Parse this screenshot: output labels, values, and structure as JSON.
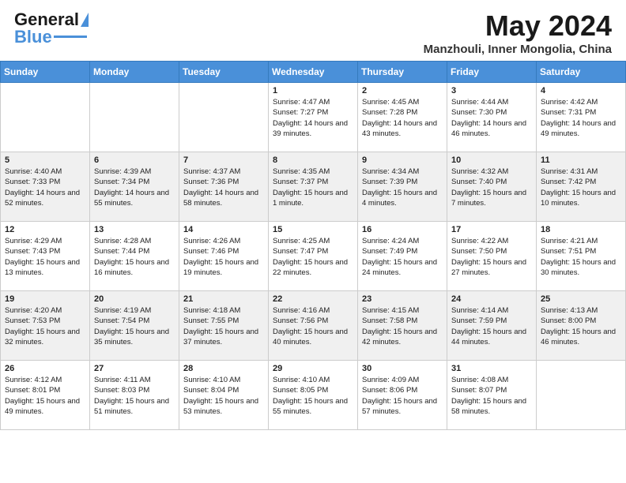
{
  "header": {
    "logo_general": "General",
    "logo_blue": "Blue",
    "month": "May 2024",
    "location": "Manzhouli, Inner Mongolia, China"
  },
  "weekdays": [
    "Sunday",
    "Monday",
    "Tuesday",
    "Wednesday",
    "Thursday",
    "Friday",
    "Saturday"
  ],
  "weeks": [
    [
      {
        "day": "",
        "sunrise": "",
        "sunset": "",
        "daylight": ""
      },
      {
        "day": "",
        "sunrise": "",
        "sunset": "",
        "daylight": ""
      },
      {
        "day": "",
        "sunrise": "",
        "sunset": "",
        "daylight": ""
      },
      {
        "day": "1",
        "sunrise": "Sunrise: 4:47 AM",
        "sunset": "Sunset: 7:27 PM",
        "daylight": "Daylight: 14 hours and 39 minutes."
      },
      {
        "day": "2",
        "sunrise": "Sunrise: 4:45 AM",
        "sunset": "Sunset: 7:28 PM",
        "daylight": "Daylight: 14 hours and 43 minutes."
      },
      {
        "day": "3",
        "sunrise": "Sunrise: 4:44 AM",
        "sunset": "Sunset: 7:30 PM",
        "daylight": "Daylight: 14 hours and 46 minutes."
      },
      {
        "day": "4",
        "sunrise": "Sunrise: 4:42 AM",
        "sunset": "Sunset: 7:31 PM",
        "daylight": "Daylight: 14 hours and 49 minutes."
      }
    ],
    [
      {
        "day": "5",
        "sunrise": "Sunrise: 4:40 AM",
        "sunset": "Sunset: 7:33 PM",
        "daylight": "Daylight: 14 hours and 52 minutes."
      },
      {
        "day": "6",
        "sunrise": "Sunrise: 4:39 AM",
        "sunset": "Sunset: 7:34 PM",
        "daylight": "Daylight: 14 hours and 55 minutes."
      },
      {
        "day": "7",
        "sunrise": "Sunrise: 4:37 AM",
        "sunset": "Sunset: 7:36 PM",
        "daylight": "Daylight: 14 hours and 58 minutes."
      },
      {
        "day": "8",
        "sunrise": "Sunrise: 4:35 AM",
        "sunset": "Sunset: 7:37 PM",
        "daylight": "Daylight: 15 hours and 1 minute."
      },
      {
        "day": "9",
        "sunrise": "Sunrise: 4:34 AM",
        "sunset": "Sunset: 7:39 PM",
        "daylight": "Daylight: 15 hours and 4 minutes."
      },
      {
        "day": "10",
        "sunrise": "Sunrise: 4:32 AM",
        "sunset": "Sunset: 7:40 PM",
        "daylight": "Daylight: 15 hours and 7 minutes."
      },
      {
        "day": "11",
        "sunrise": "Sunrise: 4:31 AM",
        "sunset": "Sunset: 7:42 PM",
        "daylight": "Daylight: 15 hours and 10 minutes."
      }
    ],
    [
      {
        "day": "12",
        "sunrise": "Sunrise: 4:29 AM",
        "sunset": "Sunset: 7:43 PM",
        "daylight": "Daylight: 15 hours and 13 minutes."
      },
      {
        "day": "13",
        "sunrise": "Sunrise: 4:28 AM",
        "sunset": "Sunset: 7:44 PM",
        "daylight": "Daylight: 15 hours and 16 minutes."
      },
      {
        "day": "14",
        "sunrise": "Sunrise: 4:26 AM",
        "sunset": "Sunset: 7:46 PM",
        "daylight": "Daylight: 15 hours and 19 minutes."
      },
      {
        "day": "15",
        "sunrise": "Sunrise: 4:25 AM",
        "sunset": "Sunset: 7:47 PM",
        "daylight": "Daylight: 15 hours and 22 minutes."
      },
      {
        "day": "16",
        "sunrise": "Sunrise: 4:24 AM",
        "sunset": "Sunset: 7:49 PM",
        "daylight": "Daylight: 15 hours and 24 minutes."
      },
      {
        "day": "17",
        "sunrise": "Sunrise: 4:22 AM",
        "sunset": "Sunset: 7:50 PM",
        "daylight": "Daylight: 15 hours and 27 minutes."
      },
      {
        "day": "18",
        "sunrise": "Sunrise: 4:21 AM",
        "sunset": "Sunset: 7:51 PM",
        "daylight": "Daylight: 15 hours and 30 minutes."
      }
    ],
    [
      {
        "day": "19",
        "sunrise": "Sunrise: 4:20 AM",
        "sunset": "Sunset: 7:53 PM",
        "daylight": "Daylight: 15 hours and 32 minutes."
      },
      {
        "day": "20",
        "sunrise": "Sunrise: 4:19 AM",
        "sunset": "Sunset: 7:54 PM",
        "daylight": "Daylight: 15 hours and 35 minutes."
      },
      {
        "day": "21",
        "sunrise": "Sunrise: 4:18 AM",
        "sunset": "Sunset: 7:55 PM",
        "daylight": "Daylight: 15 hours and 37 minutes."
      },
      {
        "day": "22",
        "sunrise": "Sunrise: 4:16 AM",
        "sunset": "Sunset: 7:56 PM",
        "daylight": "Daylight: 15 hours and 40 minutes."
      },
      {
        "day": "23",
        "sunrise": "Sunrise: 4:15 AM",
        "sunset": "Sunset: 7:58 PM",
        "daylight": "Daylight: 15 hours and 42 minutes."
      },
      {
        "day": "24",
        "sunrise": "Sunrise: 4:14 AM",
        "sunset": "Sunset: 7:59 PM",
        "daylight": "Daylight: 15 hours and 44 minutes."
      },
      {
        "day": "25",
        "sunrise": "Sunrise: 4:13 AM",
        "sunset": "Sunset: 8:00 PM",
        "daylight": "Daylight: 15 hours and 46 minutes."
      }
    ],
    [
      {
        "day": "26",
        "sunrise": "Sunrise: 4:12 AM",
        "sunset": "Sunset: 8:01 PM",
        "daylight": "Daylight: 15 hours and 49 minutes."
      },
      {
        "day": "27",
        "sunrise": "Sunrise: 4:11 AM",
        "sunset": "Sunset: 8:03 PM",
        "daylight": "Daylight: 15 hours and 51 minutes."
      },
      {
        "day": "28",
        "sunrise": "Sunrise: 4:10 AM",
        "sunset": "Sunset: 8:04 PM",
        "daylight": "Daylight: 15 hours and 53 minutes."
      },
      {
        "day": "29",
        "sunrise": "Sunrise: 4:10 AM",
        "sunset": "Sunset: 8:05 PM",
        "daylight": "Daylight: 15 hours and 55 minutes."
      },
      {
        "day": "30",
        "sunrise": "Sunrise: 4:09 AM",
        "sunset": "Sunset: 8:06 PM",
        "daylight": "Daylight: 15 hours and 57 minutes."
      },
      {
        "day": "31",
        "sunrise": "Sunrise: 4:08 AM",
        "sunset": "Sunset: 8:07 PM",
        "daylight": "Daylight: 15 hours and 58 minutes."
      },
      {
        "day": "",
        "sunrise": "",
        "sunset": "",
        "daylight": ""
      }
    ]
  ]
}
